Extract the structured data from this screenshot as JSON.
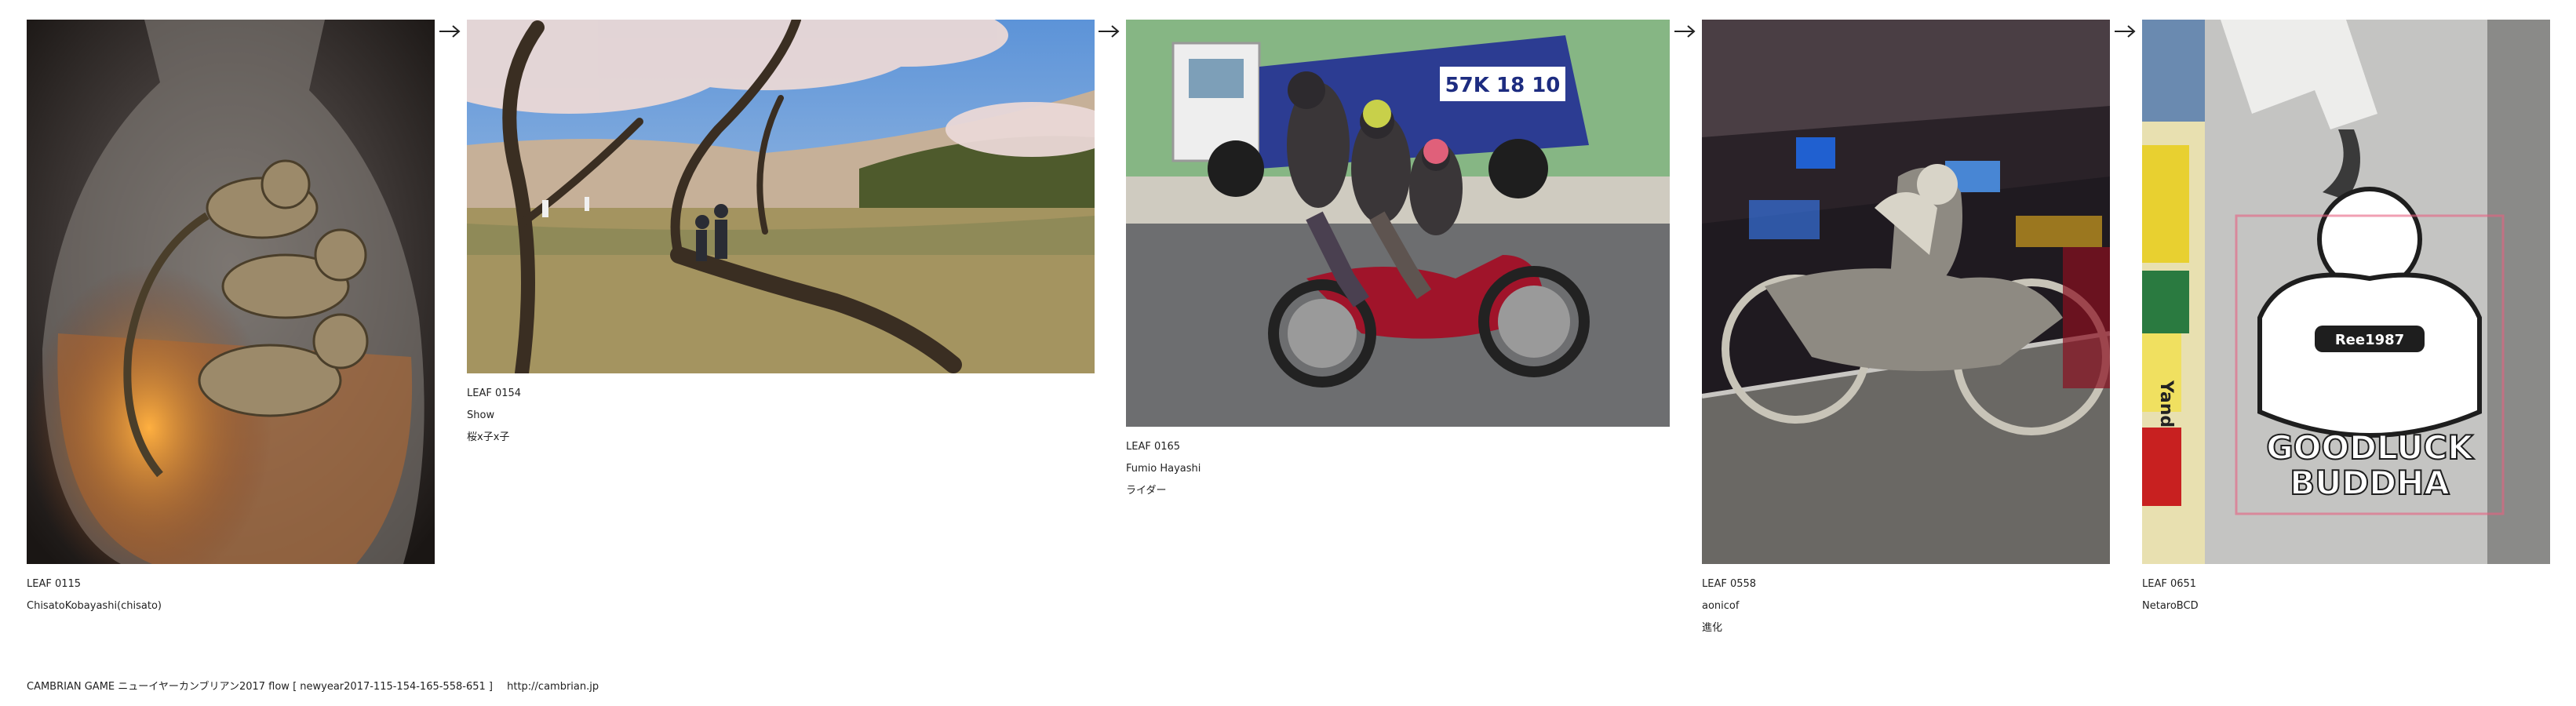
{
  "leaves": [
    {
      "code": "LEAF 0115",
      "author": "ChisatoKobayashi(chisato)",
      "caption": ""
    },
    {
      "code": "LEAF 0154",
      "author": "Show",
      "caption": "桜x子x子"
    },
    {
      "code": "LEAF 0165",
      "author": "Fumio Hayashi",
      "caption": "ライダー"
    },
    {
      "code": "LEAF 0558",
      "author": "aonicof",
      "caption": "進化"
    },
    {
      "code": "LEAF 0651",
      "author": "NetaroBCD",
      "caption": ""
    }
  ],
  "photo_texts": {
    "truck_plate": "57K 18 10",
    "buddha_badge": "Ree1987",
    "buddha_line1": "GOODLUCK",
    "buddha_line2": "BUDDHA",
    "sign_yan": "Yands"
  },
  "footer": {
    "title": "CAMBRIAN GAME  ニューイヤーカンブリアン2017  flow [ newyear2017-115-154-165-558-651 ]",
    "url": "http://cambrian.jp"
  },
  "colors": {
    "text": "#222222",
    "background": "#ffffff"
  }
}
